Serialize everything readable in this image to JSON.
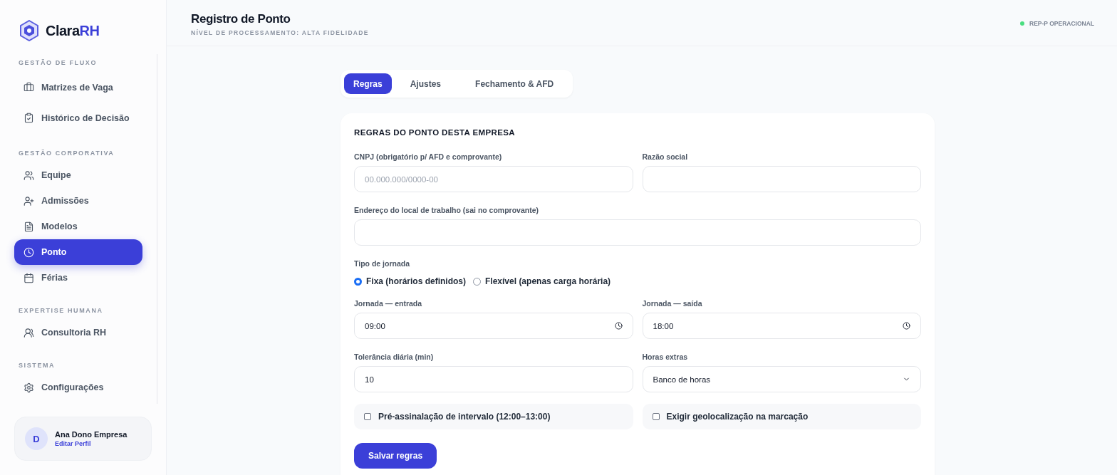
{
  "brand": {
    "name": "Clara",
    "accent": "RH"
  },
  "sidebar": {
    "sections": [
      {
        "title": "GESTÃO DE FLUXO",
        "items": [
          {
            "label": "Matrizes de Vaga",
            "selected": false
          },
          {
            "label": "Histórico de Decisão",
            "selected": false
          }
        ]
      },
      {
        "title": "GESTÃO CORPORATIVA",
        "items": [
          {
            "label": "Equipe",
            "selected": false
          },
          {
            "label": "Admissões",
            "selected": false
          },
          {
            "label": "Modelos",
            "selected": false
          },
          {
            "label": "Ponto",
            "selected": true
          },
          {
            "label": "Férias",
            "selected": false
          }
        ]
      },
      {
        "title": "EXPERTISE HUMANA",
        "items": [
          {
            "label": "Consultoria RH",
            "selected": false
          }
        ]
      },
      {
        "title": "SISTEMA",
        "items": [
          {
            "label": "Configurações",
            "selected": false
          }
        ]
      }
    ]
  },
  "user": {
    "initial": "D",
    "name": "Ana Dono Empresa",
    "link": "Editar Perfil"
  },
  "header": {
    "title": "Registro de Ponto",
    "subtitle": "NÍVEL DE PROCESSAMENTO: ALTA FIDELIDADE",
    "status": {
      "label": "REP-P OPERACIONAL",
      "color": "#4ade80"
    }
  },
  "tabs": [
    {
      "label": "Regras",
      "selected": true
    },
    {
      "label": "Ajustes",
      "selected": false
    },
    {
      "label": "Fechamento & AFD",
      "selected": false
    }
  ],
  "card": {
    "title": "REGRAS DO PONTO DESTA EMPRESA",
    "rows": [
      [
        {
          "kind": "text",
          "label": "CNPJ (obrigatório p/ AFD e comprovante)",
          "placeholder": "00.000.000/0000-00"
        },
        {
          "kind": "text",
          "label": "Razão social"
        }
      ],
      [
        {
          "kind": "text",
          "label": "Endereço do local de trabalho (sai no comprovante)"
        }
      ],
      [
        {
          "kind": "radio",
          "label": "Tipo de jornada",
          "options": [
            {
              "label": "Fixa (horários definidos)",
              "selected": true
            },
            {
              "label": "Flexível (apenas carga horária)",
              "selected": false
            }
          ]
        }
      ],
      [
        {
          "kind": "time",
          "label": "Jornada — entrada",
          "value": "09:00"
        },
        {
          "kind": "time",
          "label": "Jornada — saída",
          "value": "18:00"
        }
      ],
      [
        {
          "kind": "text",
          "label": "Tolerância diária (min)",
          "value": "10"
        },
        {
          "kind": "select",
          "label": "Horas extras",
          "value": "Banco de horas"
        }
      ],
      [
        {
          "kind": "checkbox",
          "label": "Pré-assinalação de intervalo (12:00–13:00)",
          "checked": false
        },
        {
          "kind": "checkbox",
          "label": "Exigir geolocalização na marcação",
          "checked": false
        }
      ]
    ],
    "button": "Salvar regras"
  }
}
